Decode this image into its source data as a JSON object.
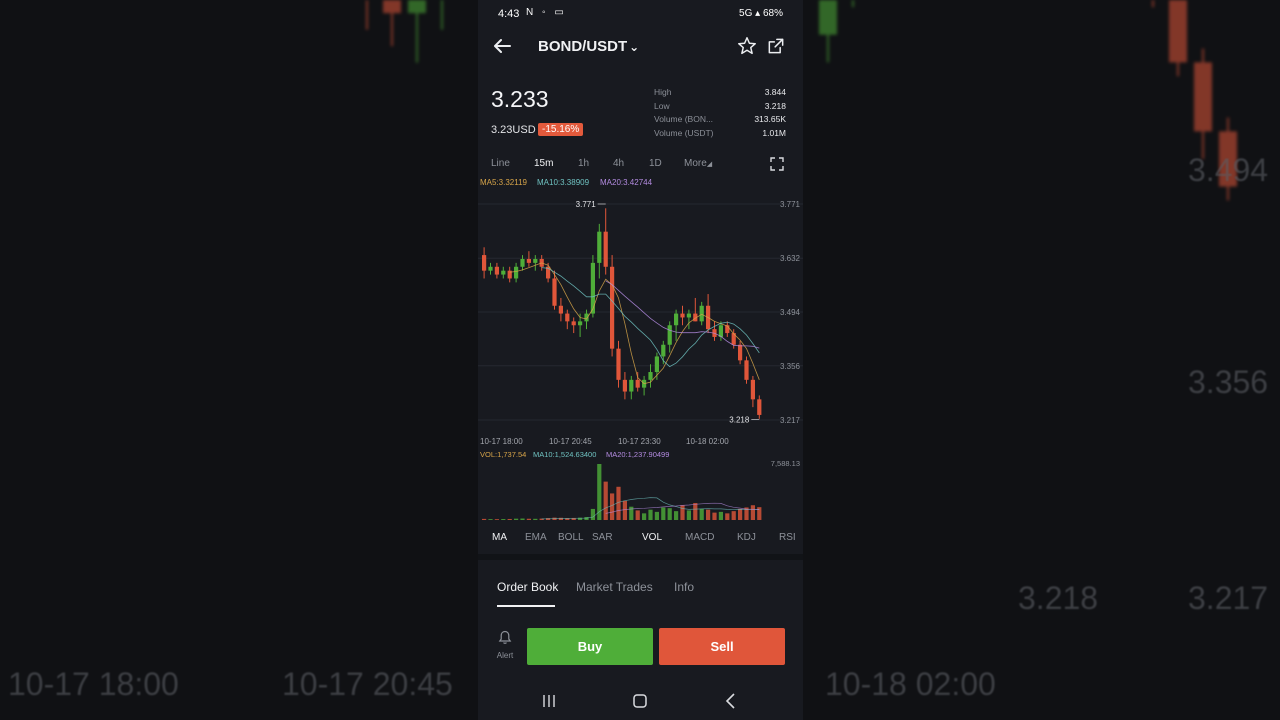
{
  "status_bar": {
    "time": "4:43",
    "left_icons": "N ◦ ▭",
    "right": "🔇 5G ▴ 68%",
    "network": "5G",
    "battery": "68%"
  },
  "header": {
    "pair": "BOND/USDT",
    "dropdown_glyph": "⌄"
  },
  "ticker": {
    "last_price": "3.233",
    "price_usd": "3.23USD",
    "change": "-15.16%",
    "stats": [
      {
        "label": "High",
        "value": "3.844"
      },
      {
        "label": "Low",
        "value": "3.218"
      },
      {
        "label": "Volume (BON...",
        "value": "313.65K"
      },
      {
        "label": "Volume (USDT)",
        "value": "1.01M"
      }
    ]
  },
  "timeframes": {
    "items": [
      "Line",
      "15m",
      "1h",
      "4h",
      "1D",
      "More"
    ],
    "active": "15m"
  },
  "ma_legend": {
    "ma5": "MA5:3.32119",
    "ma10": "MA10:3.38909",
    "ma20": "MA20:3.42744"
  },
  "vol_legend": {
    "vol": "VOL:1,737.54",
    "ma10": "MA10:1,524.63400",
    "ma20": "MA20:1,237.90499",
    "max": "7,588.13"
  },
  "price_axis": [
    "3.771",
    "3.632",
    "3.494",
    "3.356",
    "3.217"
  ],
  "time_axis": [
    "10-17 18:00",
    "10-17 20:45",
    "10-17 23:30",
    "10-18 02:00"
  ],
  "markers": {
    "high": "3.771",
    "low": "3.218"
  },
  "indicators": {
    "main": [
      "MA",
      "EMA",
      "BOLL",
      "SAR"
    ],
    "sub": [
      "VOL",
      "MACD",
      "KDJ",
      "RSI"
    ],
    "active_main": "MA",
    "active_sub": "VOL"
  },
  "tabs": {
    "items": [
      "Order Book",
      "Market Trades",
      "Info"
    ],
    "active": "Order Book"
  },
  "actions": {
    "alert": "Alert",
    "buy": "Buy",
    "sell": "Sell"
  },
  "background_labels": {
    "left": [
      "10-17 18:00",
      "10-17 20:45"
    ],
    "right_time": "10-18 02:00",
    "right_prices": [
      "3.494",
      "3.356",
      "3.218",
      "3.217"
    ]
  },
  "chart_data": {
    "type": "candlestick",
    "title": "",
    "y_axis_ticks": [
      3.771,
      3.632,
      3.494,
      3.356,
      3.217
    ],
    "ylim": [
      3.217,
      3.771
    ],
    "x_axis_ticks": [
      "10-17 18:00",
      "10-17 20:45",
      "10-17 23:30",
      "10-18 02:00"
    ],
    "interval": "15m",
    "candles": [
      [
        3.64,
        3.66,
        3.58,
        3.6
      ],
      [
        3.6,
        3.62,
        3.59,
        3.61
      ],
      [
        3.61,
        3.62,
        3.58,
        3.59
      ],
      [
        3.59,
        3.61,
        3.58,
        3.6
      ],
      [
        3.6,
        3.61,
        3.57,
        3.58
      ],
      [
        3.58,
        3.62,
        3.57,
        3.61
      ],
      [
        3.61,
        3.64,
        3.6,
        3.63
      ],
      [
        3.63,
        3.65,
        3.61,
        3.62
      ],
      [
        3.62,
        3.64,
        3.6,
        3.63
      ],
      [
        3.63,
        3.64,
        3.6,
        3.61
      ],
      [
        3.61,
        3.62,
        3.57,
        3.58
      ],
      [
        3.58,
        3.6,
        3.5,
        3.51
      ],
      [
        3.51,
        3.53,
        3.47,
        3.49
      ],
      [
        3.49,
        3.5,
        3.45,
        3.47
      ],
      [
        3.47,
        3.48,
        3.44,
        3.46
      ],
      [
        3.46,
        3.49,
        3.43,
        3.47
      ],
      [
        3.47,
        3.5,
        3.45,
        3.49
      ],
      [
        3.49,
        3.64,
        3.48,
        3.62
      ],
      [
        3.62,
        3.72,
        3.58,
        3.7
      ],
      [
        3.7,
        3.76,
        3.59,
        3.61
      ],
      [
        3.61,
        3.64,
        3.38,
        3.4
      ],
      [
        3.4,
        3.42,
        3.3,
        3.32
      ],
      [
        3.32,
        3.34,
        3.27,
        3.29
      ],
      [
        3.29,
        3.33,
        3.27,
        3.32
      ],
      [
        3.32,
        3.34,
        3.29,
        3.3
      ],
      [
        3.3,
        3.33,
        3.28,
        3.32
      ],
      [
        3.32,
        3.36,
        3.3,
        3.34
      ],
      [
        3.34,
        3.39,
        3.32,
        3.38
      ],
      [
        3.38,
        3.42,
        3.36,
        3.41
      ],
      [
        3.41,
        3.47,
        3.39,
        3.46
      ],
      [
        3.46,
        3.5,
        3.42,
        3.49
      ],
      [
        3.49,
        3.51,
        3.46,
        3.48
      ],
      [
        3.48,
        3.5,
        3.45,
        3.49
      ],
      [
        3.49,
        3.53,
        3.47,
        3.47
      ],
      [
        3.47,
        3.52,
        3.46,
        3.51
      ],
      [
        3.51,
        3.54,
        3.44,
        3.45
      ],
      [
        3.45,
        3.47,
        3.42,
        3.43
      ],
      [
        3.43,
        3.47,
        3.42,
        3.46
      ],
      [
        3.46,
        3.47,
        3.43,
        3.44
      ],
      [
        3.44,
        3.45,
        3.4,
        3.41
      ],
      [
        3.41,
        3.42,
        3.36,
        3.37
      ],
      [
        3.37,
        3.38,
        3.31,
        3.32
      ],
      [
        3.32,
        3.33,
        3.25,
        3.27
      ],
      [
        3.27,
        3.28,
        3.22,
        3.23
      ]
    ],
    "volumes": [
      150,
      120,
      110,
      130,
      140,
      180,
      200,
      170,
      160,
      190,
      260,
      320,
      300,
      240,
      280,
      310,
      400,
      1500,
      7588,
      5200,
      3600,
      4500,
      2600,
      1800,
      1300,
      900,
      1400,
      1100,
      1700,
      1600,
      1200,
      2000,
      1300,
      2300,
      1500,
      1400,
      1000,
      1100,
      900,
      1200,
      1500,
      1700,
      2000,
      1737
    ],
    "series": [
      {
        "name": "MA5",
        "color": "#d6a449"
      },
      {
        "name": "MA10",
        "color": "#6fc2c1"
      },
      {
        "name": "MA20",
        "color": "#b38be0"
      }
    ],
    "colors": {
      "up": "#4fae39",
      "down": "#e0563a"
    }
  }
}
